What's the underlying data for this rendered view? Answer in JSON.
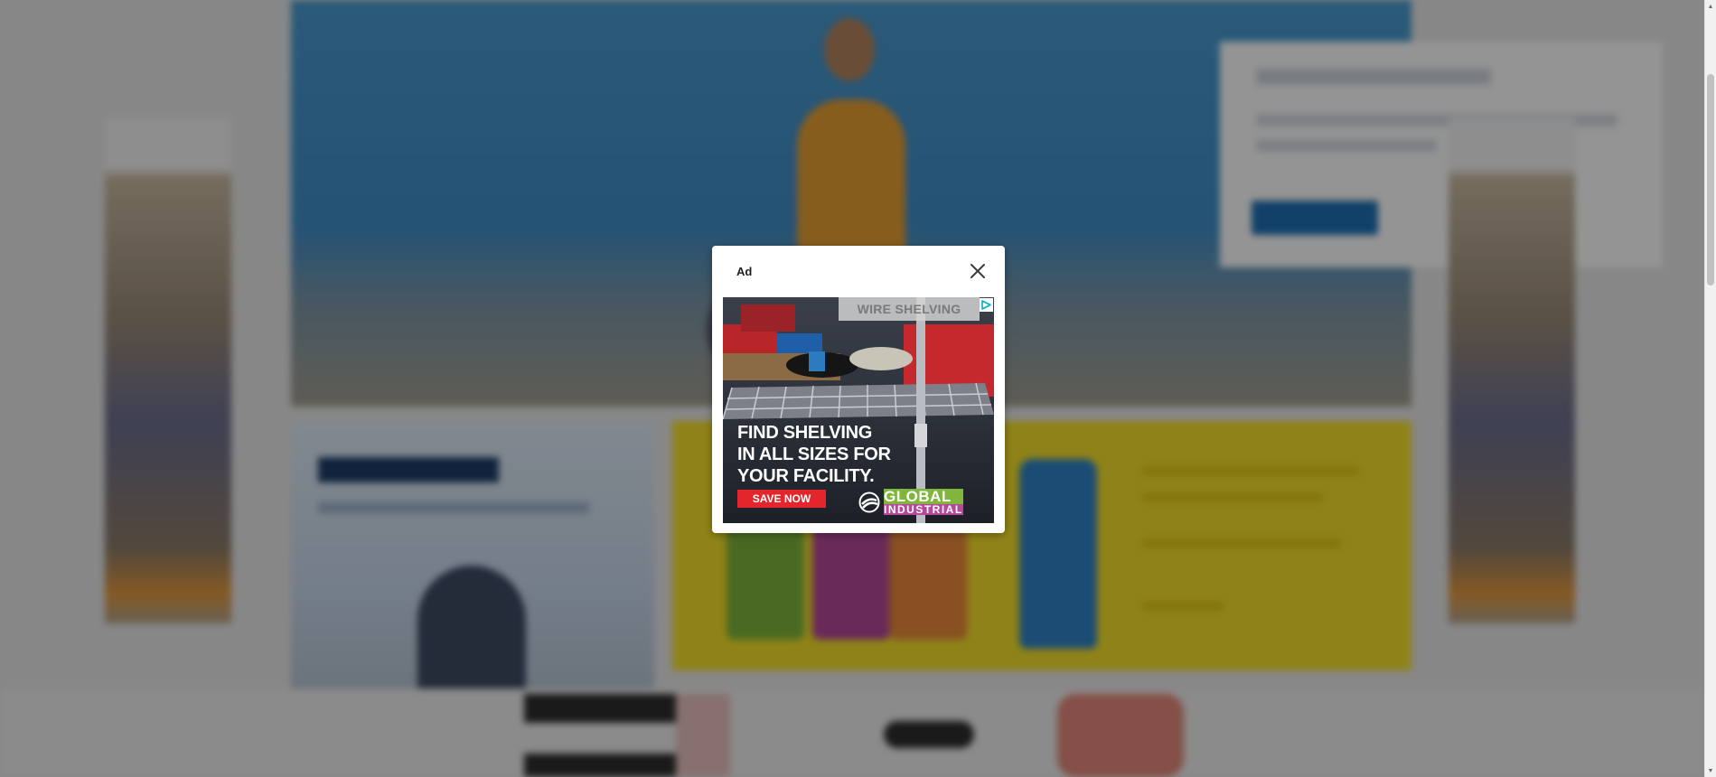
{
  "ad_modal": {
    "label": "Ad",
    "close_icon": "close-icon",
    "creative": {
      "banner_text": "WIRE SHELVING",
      "headline_lines": [
        "FIND SHELVING",
        "IN ALL SIZES FOR",
        "YOUR FACILITY."
      ],
      "cta_label": "SAVE NOW",
      "brand_line1": "GLOBAL",
      "brand_line2": "INDUSTRIAL",
      "brand_mark": "trademark-symbol-registered",
      "adchoices_icon": "adchoices-icon",
      "colors": {
        "cta": "#e3262b",
        "text": "#ffffff"
      }
    }
  },
  "background": {
    "overlay_color": "rgba(0,0,0,0.42)",
    "hero_color": "#3f8fcb",
    "promo_color": "#f6e12a"
  },
  "scrollbar": {
    "up_icon": "scroll-up-arrow-icon",
    "down_icon": "scroll-down-arrow-icon"
  }
}
